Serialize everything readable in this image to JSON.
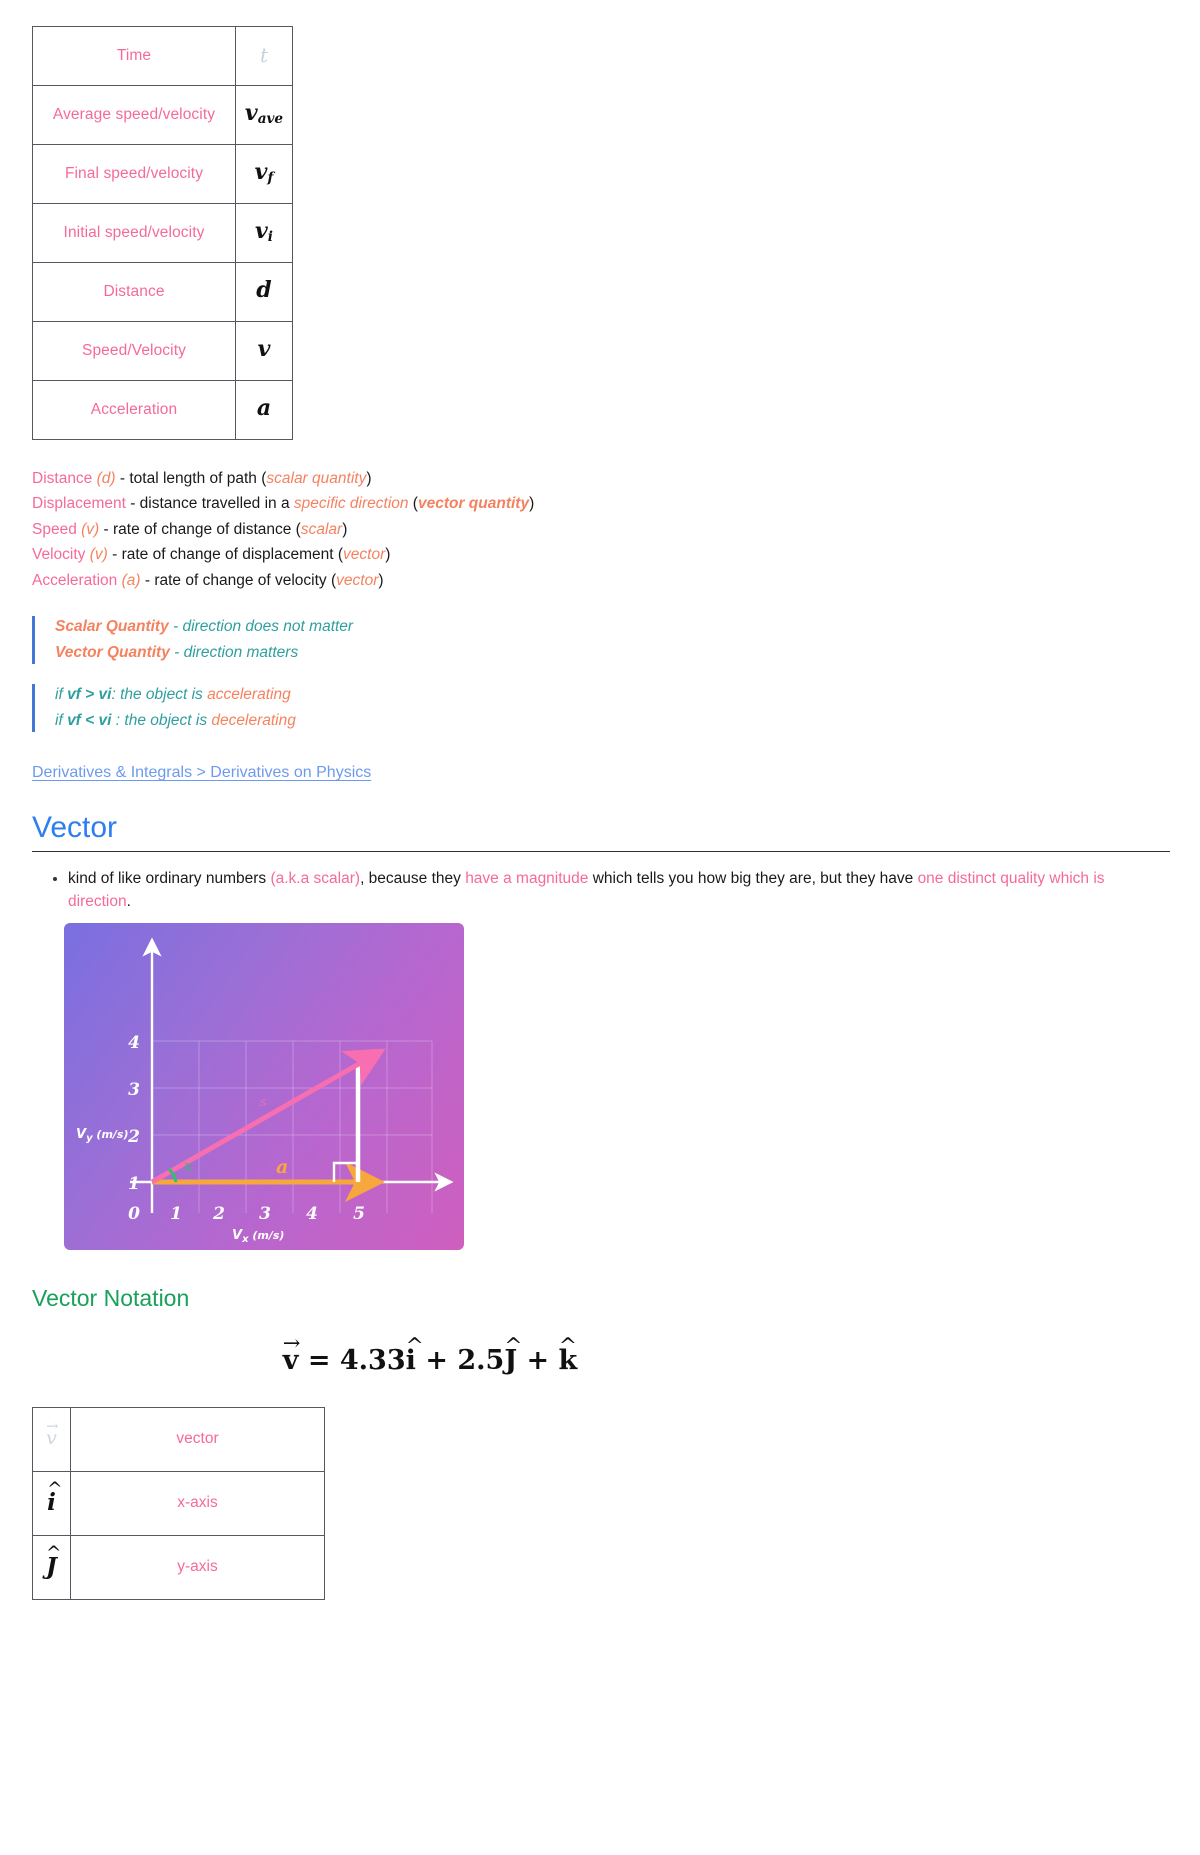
{
  "symbol_table": {
    "rows": [
      {
        "name": "Time",
        "symbol": "t",
        "sub": "",
        "muted": true
      },
      {
        "name": "Average speed/velocity",
        "symbol": "v",
        "sub": "ave",
        "muted": false
      },
      {
        "name": "Final speed/velocity",
        "symbol": "v",
        "sub": "f",
        "muted": false
      },
      {
        "name": "Initial speed/velocity",
        "symbol": "v",
        "sub": "i",
        "muted": false
      },
      {
        "name": "Distance",
        "symbol": "d",
        "sub": "",
        "muted": false
      },
      {
        "name": "Speed/Velocity",
        "symbol": "v",
        "sub": "",
        "muted": false
      },
      {
        "name": "Acceleration",
        "symbol": "a",
        "sub": "",
        "muted": false
      }
    ]
  },
  "definitions": [
    {
      "term": "Distance",
      "sym": "(d)",
      "mid": " - total length of path (",
      "hl": "scalar quantity",
      "hl_bold": false,
      "tail": ")"
    },
    {
      "term": "Displacement",
      "sym": "",
      "mid": " - distance travelled in a ",
      "hl": "specific direction",
      "hl2_pre": " (",
      "hl2": "vector quantity",
      "tail": ")"
    },
    {
      "term": "Speed",
      "sym": "(v)",
      "mid": " - rate of change of distance (",
      "hl": "scalar",
      "hl_bold": false,
      "tail": ")"
    },
    {
      "term": "Velocity",
      "sym": "(v)",
      "mid": " - rate of change of displacement (",
      "hl": "vector",
      "hl_bold": false,
      "tail": ")"
    },
    {
      "term": "Acceleration",
      "sym": "(a)",
      "mid": " - rate of change of velocity (",
      "hl": "vector",
      "hl_bold": false,
      "tail": ")"
    }
  ],
  "quote_one": {
    "line1_term": "Scalar Quantity",
    "line1_rest": " - direction does not matter",
    "line2_term": "Vector Quantity",
    "line2_rest": " - direction matters"
  },
  "quote_two": {
    "line1_if": "if ",
    "line1_a": "vf",
    "line1_op": " > ",
    "line1_b": "vi",
    "line1_mid": ": the object is ",
    "line1_hl": "accelerating",
    "line2_if": "if ",
    "line2_a": "vf",
    "line2_op": " < ",
    "line2_b": "vi",
    "line2_mid": " : the object is ",
    "line2_hl": "decelerating"
  },
  "cross_link": "Derivatives & Integrals > Derivatives on Physics",
  "section": {
    "title": "Vector"
  },
  "bullet": {
    "p1": "kind of like ordinary numbers ",
    "p2": "(a.k.a scalar)",
    "p3": ", because they ",
    "p4": "have a magnitude",
    "p5": " which tells you how big they are, but they have ",
    "p6": "one distinct quality which is direction",
    "p7": "."
  },
  "chart_data": {
    "type": "scatter",
    "title": "",
    "xlabel": "Vx (m/s)",
    "ylabel": "Vy (m/s)",
    "xticks": [
      0,
      1,
      2,
      3,
      4,
      5
    ],
    "yticks": [
      1,
      2,
      3,
      4
    ],
    "xlim": [
      0,
      5.6
    ],
    "ylim": [
      0,
      4.6
    ],
    "grid": true,
    "annotations": [
      {
        "label": "x",
        "color": "#2fbf6f",
        "note": "angle label at origin"
      },
      {
        "label": "a",
        "color": "#f7a83c",
        "note": "horizontal component label"
      },
      {
        "label": "s",
        "color": "#ef73bb",
        "note": "faint label near vector"
      }
    ],
    "vectors": [
      {
        "name": "resultant",
        "from": [
          0,
          0
        ],
        "to": [
          4.33,
          2.5
        ],
        "color": "#f76fb0"
      },
      {
        "name": "x-component",
        "from": [
          0,
          0
        ],
        "to": [
          4.33,
          0
        ],
        "color": "#f7a83c"
      },
      {
        "name": "y-component",
        "from": [
          4.33,
          0
        ],
        "to": [
          4.33,
          2.5
        ],
        "color": "#ffffff"
      }
    ]
  },
  "vector_notation": {
    "heading": "Vector Notation",
    "equation": "v = 4.33 i + 2.5 J + k",
    "eq_parts": {
      "lhs": "v",
      "eq": "=",
      "c1": "4.33",
      "u1": "i",
      "plus1": "+",
      "c2": "2.5",
      "u2": "J",
      "plus2": "+",
      "u3": "k"
    },
    "rows": [
      {
        "glyph": "v",
        "mark": "arrow",
        "desc": "vector",
        "muted": true
      },
      {
        "glyph": "i",
        "mark": "hat",
        "desc": "x-axis",
        "muted": false
      },
      {
        "glyph": "J",
        "mark": "hat",
        "desc": "y-axis",
        "muted": false
      }
    ]
  }
}
